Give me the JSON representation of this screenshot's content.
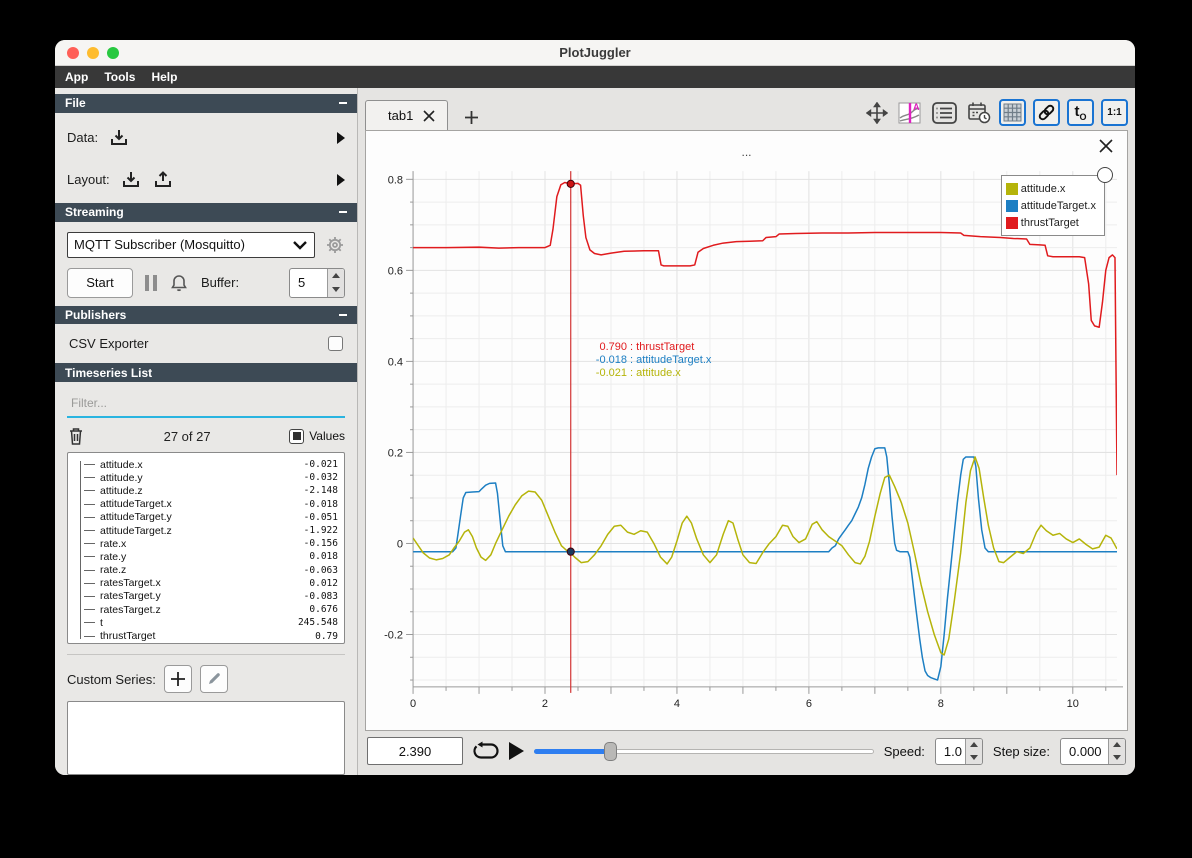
{
  "window": {
    "title": "PlotJuggler"
  },
  "menu": {
    "items": [
      "App",
      "Tools",
      "Help"
    ]
  },
  "sidebar": {
    "file": {
      "header": "File",
      "data_label": "Data:",
      "layout_label": "Layout:"
    },
    "streaming": {
      "header": "Streaming",
      "source": "MQTT Subscriber (Mosquitto)",
      "start_label": "Start",
      "buffer_label": "Buffer:",
      "buffer_value": "5"
    },
    "publishers": {
      "header": "Publishers",
      "csv_label": "CSV Exporter"
    },
    "timeseries": {
      "header": "Timeseries List",
      "filter_placeholder": "Filter...",
      "count": "27 of 27",
      "values_label": "Values",
      "items": [
        {
          "name": "attitude.x",
          "value": "-0.021"
        },
        {
          "name": "attitude.y",
          "value": "-0.032"
        },
        {
          "name": "attitude.z",
          "value": "-2.148"
        },
        {
          "name": "attitudeTarget.x",
          "value": "-0.018"
        },
        {
          "name": "attitudeTarget.y",
          "value": "-0.051"
        },
        {
          "name": "attitudeTarget.z",
          "value": "-1.922"
        },
        {
          "name": "rate.x",
          "value": "-0.156"
        },
        {
          "name": "rate.y",
          "value": "0.018"
        },
        {
          "name": "rate.z",
          "value": "-0.063"
        },
        {
          "name": "ratesTarget.x",
          "value": "0.012"
        },
        {
          "name": "ratesTarget.y",
          "value": "-0.083"
        },
        {
          "name": "ratesTarget.z",
          "value": "0.676"
        },
        {
          "name": "t",
          "value": "245.548"
        },
        {
          "name": "thrustTarget",
          "value": "0.79"
        }
      ]
    },
    "custom_series": {
      "label": "Custom Series:"
    }
  },
  "main": {
    "tab": {
      "label": "tab1"
    },
    "toolbar": {
      "t0_base": "t",
      "t0_sub": "O",
      "ratio": "1:1"
    },
    "plot": {
      "title": "...",
      "legend": [
        {
          "label": "attitude.x",
          "color": "#b5b40a"
        },
        {
          "label": "attitudeTarget.x",
          "color": "#1d7fc3"
        },
        {
          "label": "thrustTarget",
          "color": "#e01b1e"
        }
      ],
      "tooltip": [
        {
          "value": "0.790",
          "label": "thrustTarget",
          "color": "#e01b1e"
        },
        {
          "value": "-0.018",
          "label": "attitudeTarget.x",
          "color": "#1d7fc3"
        },
        {
          "value": "-0.021",
          "label": "attitude.x",
          "color": "#b5b40a"
        }
      ]
    }
  },
  "playback": {
    "time": "2.390",
    "slider_pos": 0.223,
    "speed_label": "Speed:",
    "speed": "1.0",
    "step_label": "Step size:",
    "step": "0.000"
  },
  "chart_data": {
    "type": "line",
    "title": "...",
    "xlabel": "",
    "ylabel": "",
    "xlim": [
      0,
      10.67
    ],
    "ylim": [
      -0.315,
      0.818
    ],
    "xticks": [
      0,
      2,
      4,
      6,
      8,
      10
    ],
    "yticks": [
      -0.2,
      0,
      0.2,
      0.4,
      0.6,
      0.8
    ],
    "grid": true,
    "legend_position": "top-right",
    "cursor": {
      "x": 2.39,
      "markers": [
        {
          "y": 0.79,
          "color": "#cc1414"
        },
        {
          "y": -0.018,
          "color": "#1b3a5c"
        }
      ]
    },
    "series": [
      {
        "name": "thrustTarget",
        "color": "#e01b1e",
        "points": [
          [
            0,
            0.65
          ],
          [
            0.5,
            0.65
          ],
          [
            1.0,
            0.651
          ],
          [
            1.3,
            0.649
          ],
          [
            1.6,
            0.65
          ],
          [
            2.0,
            0.65
          ],
          [
            2.08,
            0.655
          ],
          [
            2.12,
            0.69
          ],
          [
            2.18,
            0.762
          ],
          [
            2.24,
            0.788
          ],
          [
            2.3,
            0.793
          ],
          [
            2.39,
            0.79
          ],
          [
            2.5,
            0.791
          ],
          [
            2.54,
            0.787
          ],
          [
            2.58,
            0.72
          ],
          [
            2.62,
            0.672
          ],
          [
            2.68,
            0.645
          ],
          [
            2.75,
            0.637
          ],
          [
            2.85,
            0.634
          ],
          [
            3.0,
            0.638
          ],
          [
            3.2,
            0.642
          ],
          [
            3.5,
            0.643
          ],
          [
            3.72,
            0.643
          ],
          [
            3.76,
            0.612
          ],
          [
            3.8,
            0.61
          ],
          [
            4.2,
            0.61
          ],
          [
            4.27,
            0.612
          ],
          [
            4.32,
            0.64
          ],
          [
            4.4,
            0.648
          ],
          [
            4.55,
            0.655
          ],
          [
            4.7,
            0.66
          ],
          [
            4.9,
            0.663
          ],
          [
            5.1,
            0.664
          ],
          [
            5.3,
            0.665
          ],
          [
            5.35,
            0.672
          ],
          [
            5.5,
            0.674
          ],
          [
            5.55,
            0.68
          ],
          [
            5.8,
            0.681
          ],
          [
            6.2,
            0.682
          ],
          [
            6.6,
            0.682
          ],
          [
            7.0,
            0.683
          ],
          [
            7.5,
            0.683
          ],
          [
            8.0,
            0.683
          ],
          [
            8.3,
            0.682
          ],
          [
            8.35,
            0.677
          ],
          [
            8.6,
            0.674
          ],
          [
            8.9,
            0.672
          ],
          [
            9.1,
            0.67
          ],
          [
            9.3,
            0.669
          ],
          [
            9.35,
            0.657
          ],
          [
            9.5,
            0.656
          ],
          [
            9.58,
            0.655
          ],
          [
            9.62,
            0.632
          ],
          [
            9.7,
            0.63
          ],
          [
            10.1,
            0.63
          ],
          [
            10.18,
            0.628
          ],
          [
            10.24,
            0.57
          ],
          [
            10.28,
            0.49
          ],
          [
            10.33,
            0.478
          ],
          [
            10.4,
            0.475
          ],
          [
            10.45,
            0.53
          ],
          [
            10.5,
            0.6
          ],
          [
            10.55,
            0.628
          ],
          [
            10.6,
            0.634
          ],
          [
            10.64,
            0.628
          ],
          [
            10.67,
            0.15
          ]
        ]
      },
      {
        "name": "attitudeTarget.x",
        "color": "#1d7fc3",
        "points": [
          [
            0,
            -0.018
          ],
          [
            0.6,
            -0.018
          ],
          [
            0.65,
            -0.01
          ],
          [
            0.68,
            0.02
          ],
          [
            0.72,
            0.06
          ],
          [
            0.76,
            0.1
          ],
          [
            0.8,
            0.112
          ],
          [
            0.9,
            0.113
          ],
          [
            1.0,
            0.114
          ],
          [
            1.04,
            0.12
          ],
          [
            1.1,
            0.128
          ],
          [
            1.16,
            0.132
          ],
          [
            1.25,
            0.133
          ],
          [
            1.28,
            0.11
          ],
          [
            1.32,
            0.05
          ],
          [
            1.36,
            -0.005
          ],
          [
            1.4,
            -0.018
          ],
          [
            2.39,
            -0.018
          ],
          [
            4.0,
            -0.018
          ],
          [
            6.3,
            -0.018
          ],
          [
            6.35,
            -0.01
          ],
          [
            6.4,
            -0.005
          ],
          [
            6.45,
            0.01
          ],
          [
            6.5,
            0.02
          ],
          [
            6.55,
            0.03
          ],
          [
            6.6,
            0.04
          ],
          [
            6.65,
            0.05
          ],
          [
            6.7,
            0.065
          ],
          [
            6.75,
            0.08
          ],
          [
            6.8,
            0.1
          ],
          [
            6.85,
            0.13
          ],
          [
            6.9,
            0.165
          ],
          [
            6.95,
            0.19
          ],
          [
            7.0,
            0.208
          ],
          [
            7.05,
            0.21
          ],
          [
            7.15,
            0.21
          ],
          [
            7.18,
            0.19
          ],
          [
            7.22,
            0.13
          ],
          [
            7.26,
            0.06
          ],
          [
            7.3,
            0.0
          ],
          [
            7.33,
            -0.015
          ],
          [
            7.38,
            -0.018
          ],
          [
            7.5,
            -0.018
          ],
          [
            7.53,
            -0.03
          ],
          [
            7.57,
            -0.08
          ],
          [
            7.62,
            -0.14
          ],
          [
            7.68,
            -0.21
          ],
          [
            7.72,
            -0.25
          ],
          [
            7.76,
            -0.28
          ],
          [
            7.8,
            -0.29
          ],
          [
            7.85,
            -0.295
          ],
          [
            7.95,
            -0.3
          ],
          [
            8.0,
            -0.27
          ],
          [
            8.05,
            -0.2
          ],
          [
            8.1,
            -0.12
          ],
          [
            8.15,
            -0.05
          ],
          [
            8.2,
            0.02
          ],
          [
            8.25,
            0.09
          ],
          [
            8.3,
            0.15
          ],
          [
            8.34,
            0.185
          ],
          [
            8.38,
            0.19
          ],
          [
            8.5,
            0.19
          ],
          [
            8.53,
            0.17
          ],
          [
            8.57,
            0.1
          ],
          [
            8.62,
            0.03
          ],
          [
            8.67,
            -0.01
          ],
          [
            8.72,
            -0.018
          ],
          [
            9.5,
            -0.018
          ],
          [
            10.67,
            -0.018
          ]
        ]
      },
      {
        "name": "attitude.x",
        "color": "#b5b40a",
        "points": [
          [
            0,
            0.012
          ],
          [
            0.08,
            -0.005
          ],
          [
            0.15,
            -0.02
          ],
          [
            0.25,
            -0.032
          ],
          [
            0.35,
            -0.036
          ],
          [
            0.45,
            -0.033
          ],
          [
            0.55,
            -0.025
          ],
          [
            0.62,
            -0.01
          ],
          [
            0.7,
            0.005
          ],
          [
            0.78,
            0.025
          ],
          [
            0.84,
            0.03
          ],
          [
            0.9,
            0.015
          ],
          [
            0.96,
            -0.01
          ],
          [
            1.03,
            -0.03
          ],
          [
            1.1,
            -0.037
          ],
          [
            1.18,
            -0.025
          ],
          [
            1.25,
            0.0
          ],
          [
            1.35,
            0.03
          ],
          [
            1.45,
            0.06
          ],
          [
            1.55,
            0.085
          ],
          [
            1.65,
            0.105
          ],
          [
            1.75,
            0.115
          ],
          [
            1.85,
            0.113
          ],
          [
            1.95,
            0.095
          ],
          [
            2.05,
            0.06
          ],
          [
            2.15,
            0.025
          ],
          [
            2.25,
            -0.005
          ],
          [
            2.35,
            -0.018
          ],
          [
            2.39,
            -0.021
          ],
          [
            2.45,
            -0.03
          ],
          [
            2.55,
            -0.042
          ],
          [
            2.65,
            -0.04
          ],
          [
            2.75,
            -0.025
          ],
          [
            2.85,
            -0.005
          ],
          [
            2.95,
            0.02
          ],
          [
            3.05,
            0.038
          ],
          [
            3.15,
            0.04
          ],
          [
            3.25,
            0.025
          ],
          [
            3.35,
            0.02
          ],
          [
            3.45,
            0.028
          ],
          [
            3.55,
            0.025
          ],
          [
            3.65,
            0.0
          ],
          [
            3.75,
            -0.03
          ],
          [
            3.85,
            -0.045
          ],
          [
            3.92,
            -0.03
          ],
          [
            4.0,
            0.005
          ],
          [
            4.08,
            0.045
          ],
          [
            4.15,
            0.06
          ],
          [
            4.22,
            0.045
          ],
          [
            4.3,
            0.01
          ],
          [
            4.4,
            -0.025
          ],
          [
            4.5,
            -0.042
          ],
          [
            4.6,
            -0.025
          ],
          [
            4.7,
            0.02
          ],
          [
            4.78,
            0.05
          ],
          [
            4.85,
            0.045
          ],
          [
            4.92,
            0.01
          ],
          [
            5.0,
            -0.025
          ],
          [
            5.1,
            -0.042
          ],
          [
            5.2,
            -0.044
          ],
          [
            5.3,
            -0.02
          ],
          [
            5.4,
            0.0
          ],
          [
            5.5,
            0.015
          ],
          [
            5.6,
            0.04
          ],
          [
            5.68,
            0.038
          ],
          [
            5.76,
            0.015
          ],
          [
            5.85,
            0.002
          ],
          [
            5.95,
            0.01
          ],
          [
            6.05,
            0.042
          ],
          [
            6.12,
            0.048
          ],
          [
            6.2,
            0.03
          ],
          [
            6.3,
            0.015
          ],
          [
            6.4,
            0.005
          ],
          [
            6.5,
            -0.005
          ],
          [
            6.6,
            -0.025
          ],
          [
            6.7,
            -0.042
          ],
          [
            6.78,
            -0.045
          ],
          [
            6.85,
            -0.028
          ],
          [
            6.92,
            0.005
          ],
          [
            7.0,
            0.06
          ],
          [
            7.08,
            0.11
          ],
          [
            7.15,
            0.145
          ],
          [
            7.22,
            0.15
          ],
          [
            7.3,
            0.125
          ],
          [
            7.4,
            0.09
          ],
          [
            7.5,
            0.045
          ],
          [
            7.6,
            -0.02
          ],
          [
            7.7,
            -0.09
          ],
          [
            7.8,
            -0.15
          ],
          [
            7.9,
            -0.2
          ],
          [
            8.0,
            -0.24
          ],
          [
            8.05,
            -0.245
          ],
          [
            8.12,
            -0.21
          ],
          [
            8.2,
            -0.13
          ],
          [
            8.3,
            -0.02
          ],
          [
            8.38,
            0.09
          ],
          [
            8.45,
            0.16
          ],
          [
            8.52,
            0.19
          ],
          [
            8.58,
            0.165
          ],
          [
            8.65,
            0.1
          ],
          [
            8.72,
            0.04
          ],
          [
            8.8,
            -0.01
          ],
          [
            8.88,
            -0.04
          ],
          [
            8.95,
            -0.042
          ],
          [
            9.05,
            -0.03
          ],
          [
            9.15,
            -0.018
          ],
          [
            9.25,
            -0.022
          ],
          [
            9.35,
            -0.01
          ],
          [
            9.45,
            0.025
          ],
          [
            9.52,
            0.04
          ],
          [
            9.6,
            0.028
          ],
          [
            9.7,
            0.018
          ],
          [
            9.8,
            0.022
          ],
          [
            9.9,
            0.01
          ],
          [
            10.0,
            0.002
          ],
          [
            10.1,
            0.01
          ],
          [
            10.2,
            -0.002
          ],
          [
            10.3,
            -0.012
          ],
          [
            10.4,
            -0.008
          ],
          [
            10.5,
            0.018
          ],
          [
            10.58,
            0.012
          ],
          [
            10.67,
            -0.012
          ]
        ]
      }
    ]
  }
}
